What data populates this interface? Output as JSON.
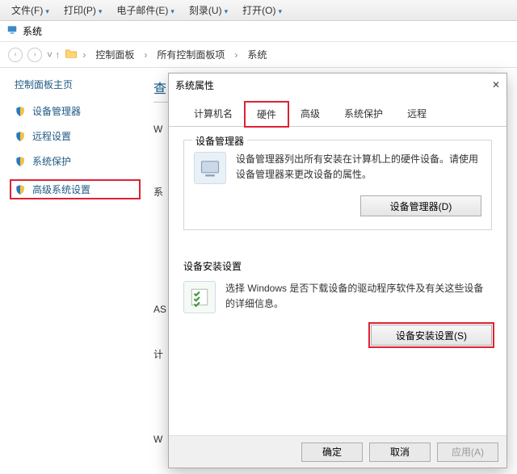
{
  "menu": {
    "file": "文件(F)",
    "print": "打印(P)",
    "email": "电子邮件(E)",
    "burn": "刻录(U)",
    "open": "打开(O)"
  },
  "window": {
    "title": "系统"
  },
  "breadcrumb": {
    "root": "控制面板",
    "mid": "所有控制面板项",
    "leaf": "系统"
  },
  "sidebar": {
    "home": "控制面板主页",
    "items": [
      {
        "label": "设备管理器"
      },
      {
        "label": "远程设置"
      },
      {
        "label": "系统保护"
      },
      {
        "label": "高级系统设置"
      }
    ]
  },
  "content": {
    "heading_fragment": "查",
    "row_labels": [
      "W",
      "系",
      "AS",
      "计",
      "W"
    ]
  },
  "dialog": {
    "title": "系统属性",
    "tabs": {
      "computer_name": "计算机名",
      "hardware": "硬件",
      "advanced": "高级",
      "system_protection": "系统保护",
      "remote": "远程"
    },
    "device_manager": {
      "title": "设备管理器",
      "desc": "设备管理器列出所有安装在计算机上的硬件设备。请使用设备管理器来更改设备的属性。",
      "button": "设备管理器(D)"
    },
    "device_install": {
      "title": "设备安装设置",
      "desc": "选择 Windows 是否下载设备的驱动程序软件及有关这些设备的详细信息。",
      "button": "设备安装设置(S)"
    },
    "footer": {
      "ok": "确定",
      "cancel": "取消",
      "apply": "应用(A)"
    }
  }
}
